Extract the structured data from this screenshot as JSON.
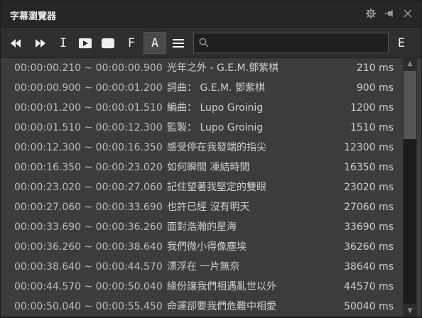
{
  "window": {
    "title": "字幕瀏覽器"
  },
  "titlebar_icons": [
    "gear-icon",
    "pin-icon",
    "close-icon"
  ],
  "toolbar": {
    "f_label": "F",
    "a_label": "A",
    "i_label": "I",
    "e_label": "E"
  },
  "search": {
    "value": "",
    "placeholder": ""
  },
  "subtitles": [
    {
      "time": "00:00:00.210 ~ 00:00:00.900",
      "text": "光年之外 - G.E.M.鄧紫棋",
      "dur": "210 ms"
    },
    {
      "time": "00:00:00.900 ~ 00:00:01.200",
      "text": "詞曲： G.E.M. 鄧紫棋",
      "dur": "900 ms"
    },
    {
      "time": "00:00:01.200 ~ 00:00:01.510",
      "text": "編曲： Lupo Groinig",
      "dur": "1200 ms"
    },
    {
      "time": "00:00:01.510 ~ 00:00:12.300",
      "text": "監製： Lupo Groinig",
      "dur": "1510 ms"
    },
    {
      "time": "00:00:12.300 ~ 00:00:16.350",
      "text": "感受停在我發端的指尖",
      "dur": "12300 ms"
    },
    {
      "time": "00:00:16.350 ~ 00:00:23.020",
      "text": "如何瞬間 凍結時間",
      "dur": "16350 ms"
    },
    {
      "time": "00:00:23.020 ~ 00:00:27.060",
      "text": "記住望著我堅定的雙眼",
      "dur": "23020 ms"
    },
    {
      "time": "00:00:27.060 ~ 00:00:33.690",
      "text": "也許已經 沒有明天",
      "dur": "27060 ms"
    },
    {
      "time": "00:00:33.690 ~ 00:00:36.260",
      "text": "面對浩瀚的星海",
      "dur": "33690 ms"
    },
    {
      "time": "00:00:36.260 ~ 00:00:38.640",
      "text": "我們微小得像塵埃",
      "dur": "36260 ms"
    },
    {
      "time": "00:00:38.640 ~ 00:00:44.570",
      "text": "漂浮在 一片無奈",
      "dur": "38640 ms"
    },
    {
      "time": "00:00:44.570 ~ 00:00:50.040",
      "text": "緣份讓我們相遇亂世以外",
      "dur": "44570 ms"
    },
    {
      "time": "00:00:50.040 ~ 00:00:55.450",
      "text": "命運卻要我們危難中相愛",
      "dur": "50040 ms"
    }
  ],
  "scroll": {
    "position": 0.0
  }
}
